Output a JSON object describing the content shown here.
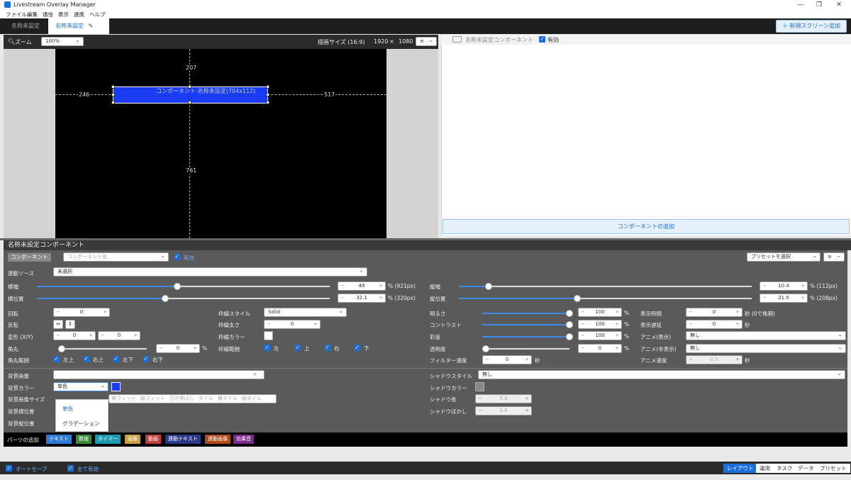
{
  "window": {
    "title": "Livestream Overlay Manager"
  },
  "menu": [
    "ファイル",
    "編集",
    "通信",
    "表示",
    "連携",
    "ヘルプ"
  ],
  "tabs": [
    {
      "label": "名称未設定"
    },
    {
      "label": "名称未設定"
    }
  ],
  "new_screen_button": "新規スクリーン追加",
  "canvas_toolbar": {
    "zoom_label": "ズーム",
    "zoom_value": "100%",
    "size_label": "描画サイズ (16:9)",
    "width": "1920",
    "x": "×",
    "height": "1080",
    "menu_icon": "≡"
  },
  "canvas": {
    "top": "207",
    "left": "246",
    "right": "517",
    "bottom": "761",
    "component_label": "コンポーネント:名称未設定(704x112)"
  },
  "component_list": {
    "name": "名称未設定コンポーネント",
    "enabled_label": "有効",
    "add_button": "コンポーネントの追加"
  },
  "properties": {
    "section_title": "名称未設定コンポーネント",
    "type_badge": "コンポーネント",
    "name_placeholder": "コンポーネント名",
    "enabled": "有効",
    "preset_select": "プリセットを選択",
    "source_label": "連動ソース",
    "source_value": "未選択",
    "width_label": "横幅",
    "width_value": "48",
    "width_unit": "% (921px)",
    "width_level": 0.48,
    "hpos_label": "横位置",
    "hpos_value": "32.1",
    "hpos_unit": "% (320px)",
    "hpos_level": 0.4,
    "height_label": "縦幅",
    "height_value": "10.4",
    "height_unit": "% (112px)",
    "height_level": 0.1,
    "vpos_label": "縦位置",
    "vpos_value": "21.5",
    "vpos_unit": "% (208px)",
    "vpos_level": 0.4,
    "rotate_label": "回転",
    "rotate_value": "0",
    "flip_label": "反転",
    "flip_h": "↔",
    "flip_v": "↕",
    "skew_label": "変形 (X/Y)",
    "skew_x": "0",
    "skew_y": "0",
    "radius_label": "角丸",
    "radius_value": "0",
    "radius_unit": "%",
    "radius_range_label": "角丸範囲",
    "radius_tl": "左上",
    "radius_tr": "右上",
    "radius_bl": "左下",
    "radius_br": "右下",
    "border_style_label": "枠線スタイル",
    "border_style_value": "Solid",
    "border_width_label": "枠線太さ",
    "border_width_value": "0",
    "border_color_label": "枠線カラー",
    "border_range_label": "枠線範囲",
    "border_left": "左",
    "border_top": "上",
    "border_right": "右",
    "border_bottom": "下",
    "brightness_label": "明るさ",
    "brightness_value": "100",
    "contrast_label": "コントラスト",
    "contrast_value": "100",
    "saturation_label": "彩度",
    "saturation_value": "100",
    "opacity_label": "透明度",
    "opacity_value": "0",
    "pct": "%",
    "filter_speed_label": "フィルター速度",
    "filter_speed_value": "0",
    "sec": "秒",
    "show_time_label": "表示時間",
    "show_time_value": "0",
    "show_time_unit": "秒 (0で無期)",
    "show_delay_label": "表示遅延",
    "show_delay_value": "0",
    "anim_show_label": "アニメ(表示)",
    "anim_show_value": "無し",
    "anim_hide_label": "アニメ(非表示)",
    "anim_hide_value": "無し",
    "anim_speed_label": "アニメ速度",
    "anim_speed_value": "0.5",
    "bg_image_label": "背景画像",
    "bg_color_label": "背景カラー",
    "bg_color_value": "単色",
    "bg_size_label": "背景画像サイズ",
    "bg_size_options": [
      "横フィット",
      "縦フィット",
      "引き伸ばし",
      "タイル",
      "横タイル",
      "縦タイル"
    ],
    "bg_hpos_label": "背景横位置",
    "bg_vpos_label": "背景縦位置",
    "dropdown_options": [
      "単色",
      "グラデーション"
    ],
    "shadow_style_label": "シャドウスタイル",
    "shadow_style_value": "無し",
    "shadow_color_label": "シャドウカラー",
    "shadow_length_label": "シャドウ長",
    "shadow_length_value": "5.8",
    "shadow_blur_label": "シャドウぼかし",
    "shadow_blur_value": "3.6"
  },
  "parts": {
    "label": "パーツの追加",
    "buttons": [
      {
        "label": "テキスト",
        "color": "#2c7bd6"
      },
      {
        "label": "数値",
        "color": "#3a8a3a"
      },
      {
        "label": "タイマー",
        "color": "#1b9ab0"
      },
      {
        "label": "画像",
        "color": "#c8a040"
      },
      {
        "label": "動画",
        "color": "#c04040"
      },
      {
        "label": "連動テキスト",
        "color": "#2a3a8a"
      },
      {
        "label": "連動画像",
        "color": "#b04a1a"
      },
      {
        "label": "効果音",
        "color": "#7a2a8a"
      }
    ]
  },
  "bottom": {
    "autosave": "オートセーブ",
    "all_enabled": "全て有効",
    "tabs": [
      "レイアウト",
      "運用",
      "タスク",
      "データ",
      "プリセット"
    ]
  }
}
